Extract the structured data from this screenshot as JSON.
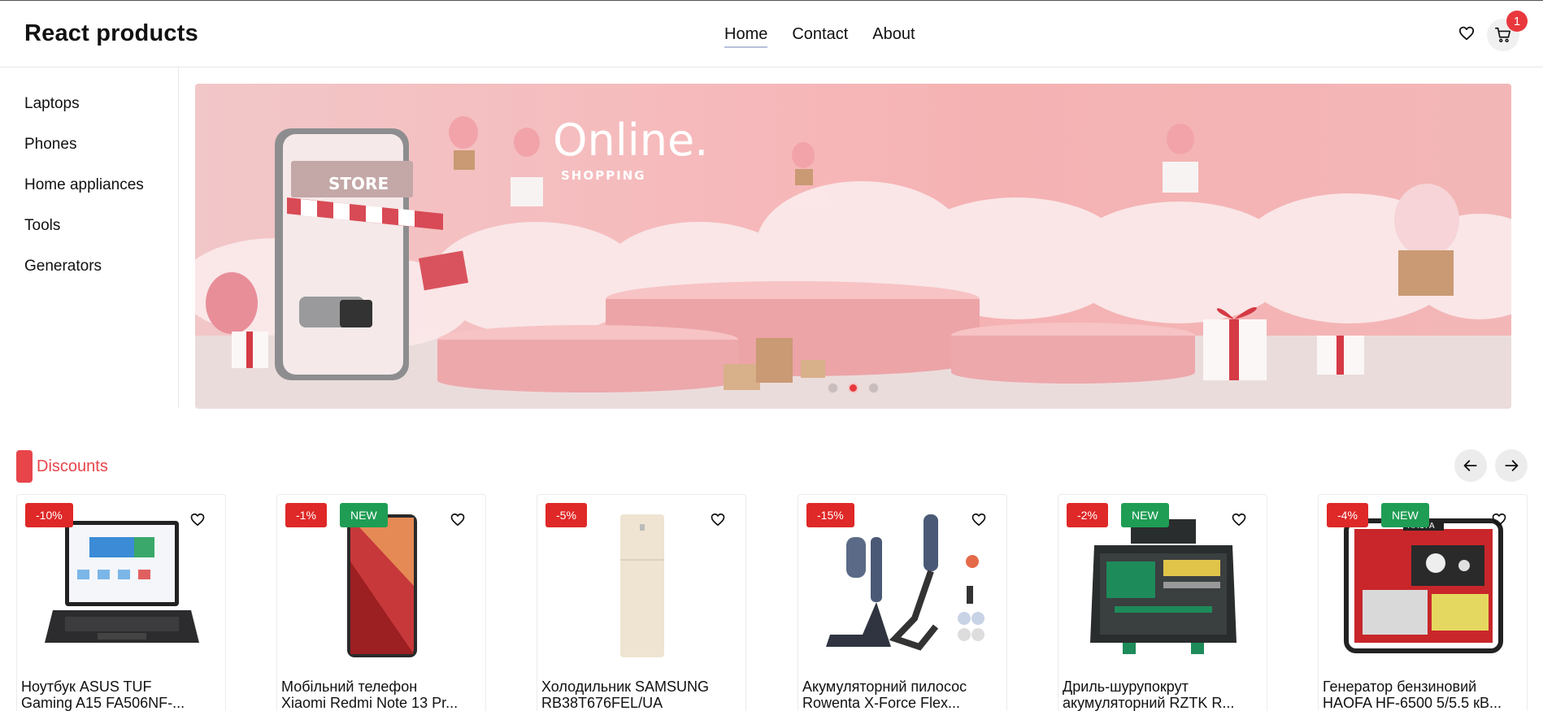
{
  "header": {
    "logo": "React products",
    "nav": [
      "Home",
      "Contact",
      "About"
    ],
    "cart_count": "1"
  },
  "sidebar": {
    "items": [
      "Laptops",
      "Phones",
      "Home appliances",
      "Tools",
      "Generators"
    ]
  },
  "banner": {
    "title": "Online.",
    "subtitle": "SHOPPING",
    "store_sign": "STORE",
    "active_slide": 2,
    "slide_count": 3
  },
  "section": {
    "title": "Discounts"
  },
  "products": [
    {
      "discount": "-10%",
      "new": "",
      "title": "Ноутбук ASUS TUF\nGaming A15 FA506NF-..."
    },
    {
      "discount": "-1%",
      "new": "NEW",
      "title": "Мобільний телефон\nXiaomi Redmi Note 13 Pr..."
    },
    {
      "discount": "-5%",
      "new": "",
      "title": "Холодильник SAMSUNG\nRB38T676FEL/UA"
    },
    {
      "discount": "-15%",
      "new": "",
      "title": "Акумуляторний пилосос\nRowenta X-Force Flex..."
    },
    {
      "discount": "-2%",
      "new": "NEW",
      "title": "Дриль-шурупокрут\nакумуляторний RZTK R..."
    },
    {
      "discount": "-4%",
      "new": "NEW",
      "title": "Генератор бензиновий\nHAOFA HF-6500 5/5.5 кВ..."
    }
  ],
  "colors": {
    "accent": "#e8454a",
    "discount_badge": "#df2828",
    "new_badge": "#1f9d55"
  }
}
